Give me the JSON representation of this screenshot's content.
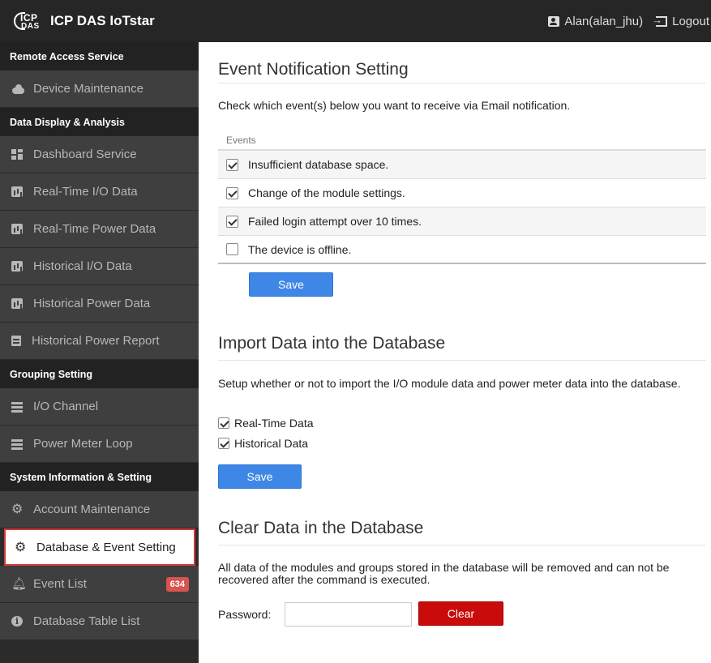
{
  "app": {
    "logo_top": "ICP",
    "logo_bottom": "DAS",
    "title": "ICP DAS IoTstar",
    "user": "Alan(alan_jhu)",
    "logout": "Logout"
  },
  "sidebar": {
    "sections": [
      {
        "title": "Remote Access Service",
        "items": [
          {
            "label": "Device Maintenance",
            "icon": "cloud-icon"
          }
        ]
      },
      {
        "title": "Data Display & Analysis",
        "items": [
          {
            "label": "Dashboard Service",
            "icon": "dashboard-icon"
          },
          {
            "label": "Real-Time I/O Data",
            "icon": "bar-chart-icon"
          },
          {
            "label": "Real-Time Power Data",
            "icon": "bar-chart-icon"
          },
          {
            "label": "Historical I/O Data",
            "icon": "bar-chart-icon"
          },
          {
            "label": "Historical Power Data",
            "icon": "bar-chart-icon"
          },
          {
            "label": "Historical Power Report",
            "icon": "report-icon"
          }
        ]
      },
      {
        "title": "Grouping Setting",
        "items": [
          {
            "label": "I/O Channel",
            "icon": "list-icon"
          },
          {
            "label": "Power Meter Loop",
            "icon": "list-icon"
          }
        ]
      },
      {
        "title": "System Information & Setting",
        "items": [
          {
            "label": "Account Maintenance",
            "icon": "gear-icon"
          },
          {
            "label": "Database & Event Setting",
            "icon": "gear-icon"
          },
          {
            "label": "Event List",
            "icon": "bell-icon",
            "badge": "634"
          },
          {
            "label": "Database Table List",
            "icon": "info-icon"
          }
        ]
      }
    ]
  },
  "event_section": {
    "title": "Event Notification Setting",
    "description": "Check which event(s) below you want to receive via Email notification.",
    "column_header": "Events",
    "events": [
      {
        "label": "Insufficient database space.",
        "checked": true
      },
      {
        "label": "Change of the module settings.",
        "checked": true
      },
      {
        "label": "Failed login attempt over 10 times.",
        "checked": true
      },
      {
        "label": "The device is offline.",
        "checked": false
      }
    ],
    "save_label": "Save"
  },
  "import_section": {
    "title": "Import Data into the Database",
    "description": "Setup whether or not to import the I/O module data and power meter data into the database.",
    "options": [
      {
        "label": "Real-Time Data",
        "checked": true
      },
      {
        "label": "Historical Data",
        "checked": true
      }
    ],
    "save_label": "Save"
  },
  "clear_section": {
    "title": "Clear Data in the Database",
    "description": "All data of the modules and groups stored in the database will be removed and can not be recovered after the command is executed.",
    "password_label": "Password:",
    "password_value": "",
    "clear_label": "Clear"
  },
  "colors": {
    "topbar": "#262626",
    "sidebar": "#3f3f3f",
    "active_border": "#d43a3a",
    "save_button": "#3f87e6",
    "clear_button": "#c90b0b",
    "badge": "#d9534f"
  }
}
